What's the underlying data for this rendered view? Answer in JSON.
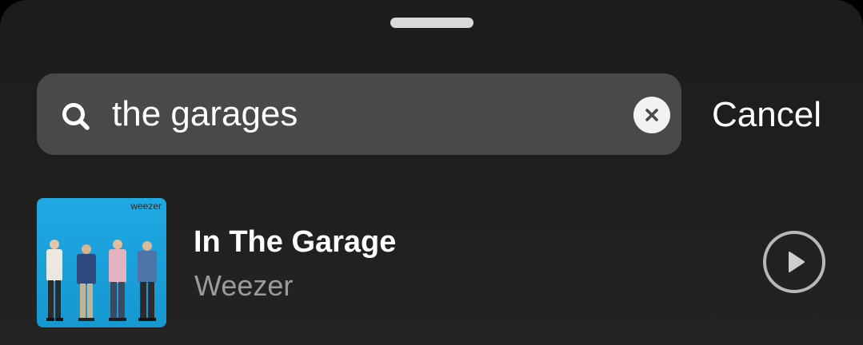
{
  "search": {
    "query": "the garages",
    "cancel_label": "Cancel"
  },
  "results": [
    {
      "title": "In The Garage",
      "artist": "Weezer",
      "album_art_text": "weezer"
    }
  ],
  "colors": {
    "sheet_background": "#1f1e1d",
    "search_field": "#4a4948",
    "primary_text": "#ffffff",
    "secondary_text": "#9c9b9a",
    "album_blue": "#1aa3dd"
  },
  "icons": {
    "search": "search-icon",
    "clear": "close-icon",
    "play": "play-icon"
  }
}
